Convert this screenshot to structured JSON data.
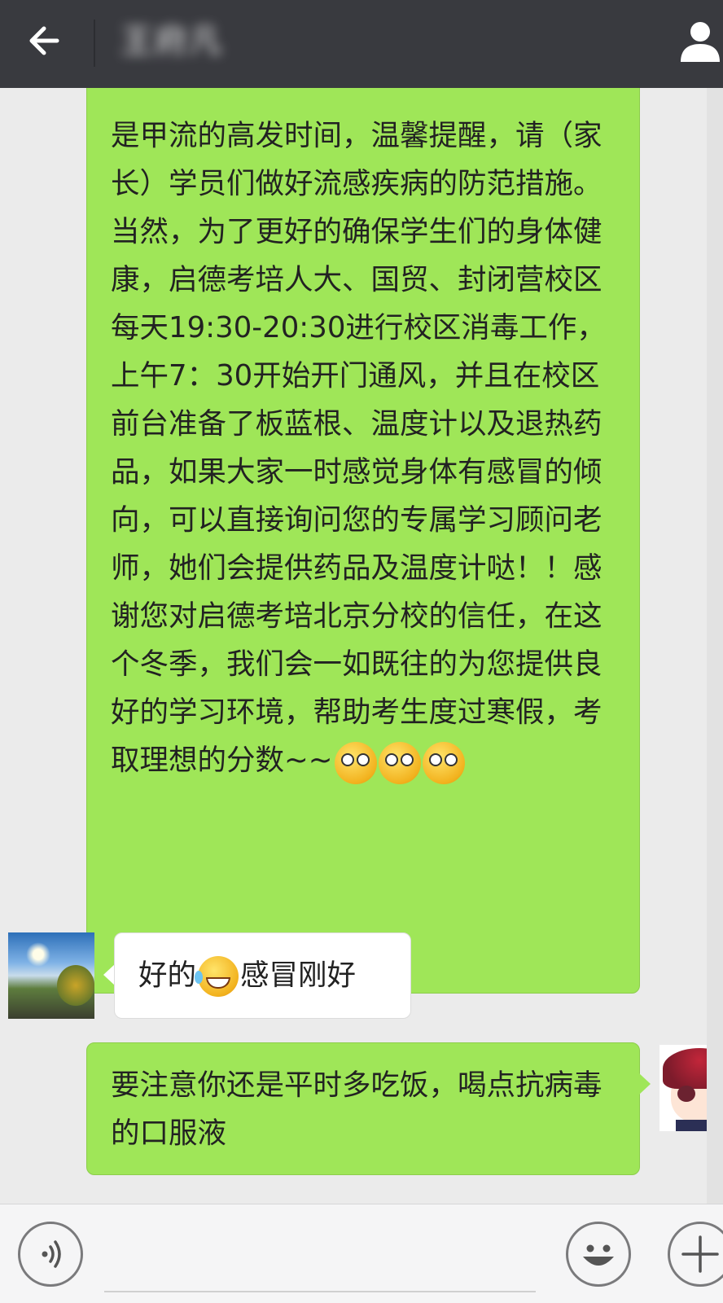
{
  "header": {
    "title": "王府凡"
  },
  "messages": [
    {
      "side": "right",
      "text": "是甲流的高发时间，温馨提醒，请（家长）学员们做好流感疾病的防范措施。当然，为了更好的确保学生们的身体健康，启德考培人大、国贸、封闭营校区每天19:30-20:30进行校区消毒工作，上午7：30开始开门通风，并且在校区前台准备了板蓝根、温度计以及退热药品，如果大家一时感觉身体有感冒的倾向，可以直接询问您的专属学习顾问老师，她们会提供药品及温度计哒！！感谢您对启德考培北京分校的信任，在这个冬季，我们会一如既往的为您提供良好的学习环境，帮助考生度过寒假，考取理想的分数~~",
      "emoji": [
        "thinking-face",
        "thinking-face",
        "thinking-face"
      ]
    },
    {
      "side": "left",
      "text_before": "好的",
      "emoji": "laughing-tears",
      "text_after": "感冒刚好"
    },
    {
      "side": "right",
      "text": "要注意你还是平时多吃饭，喝点抗病毒的口服液"
    }
  ],
  "icons": {
    "back": "arrow-left-icon",
    "user": "person-icon",
    "voice": "voice-icon",
    "emoji": "smiley-icon",
    "plus": "plus-icon"
  },
  "colors": {
    "topbar": "#393a3f",
    "bubble_green": "#9fe658",
    "bubble_white": "#ffffff",
    "background": "#ebebeb"
  }
}
